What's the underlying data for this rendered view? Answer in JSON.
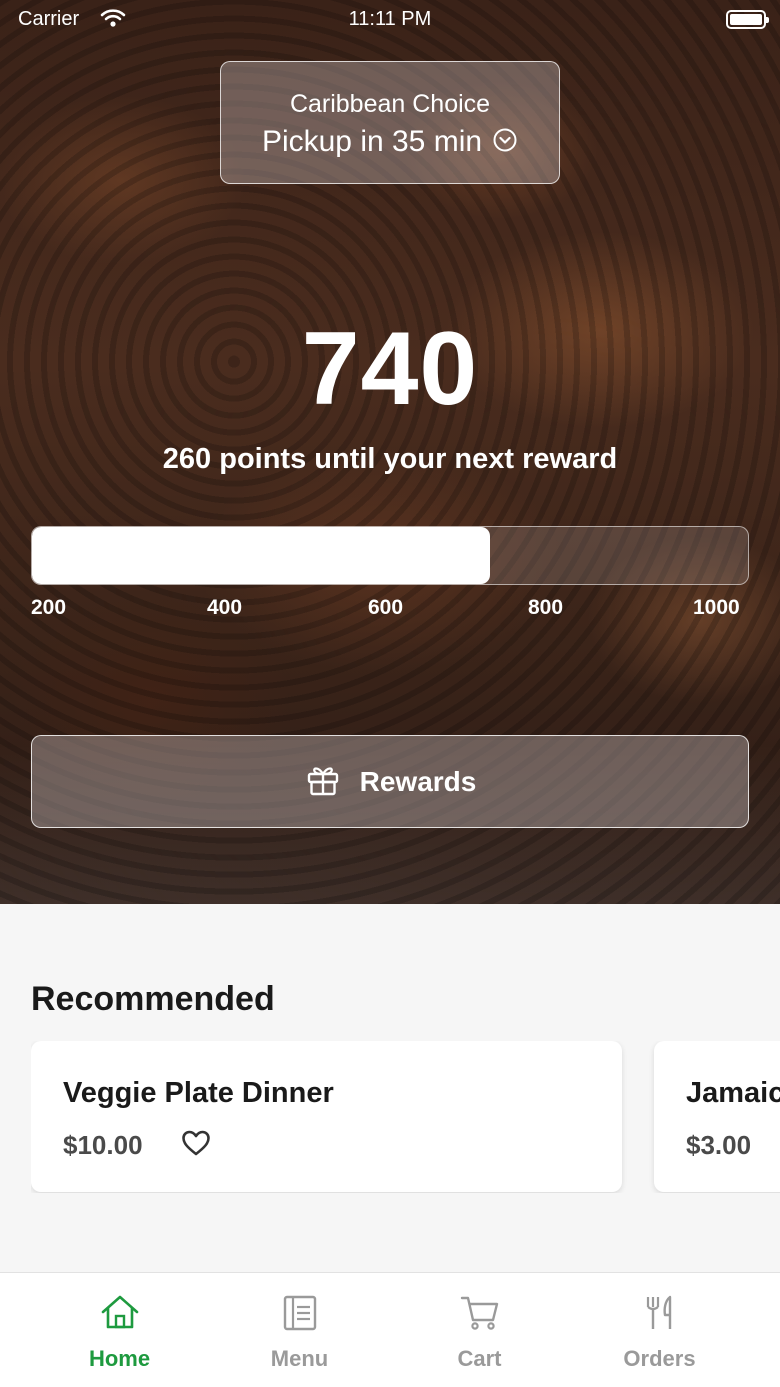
{
  "status_bar": {
    "carrier": "Carrier",
    "time": "11:11 PM"
  },
  "header": {
    "store_name": "Caribbean Choice",
    "pickup_label": "Pickup in 35 min"
  },
  "rewards": {
    "points": "740",
    "message": "260 points until your next reward",
    "progress_fraction": 0.64,
    "ticks": [
      "200",
      "400",
      "600",
      "800",
      "1000"
    ],
    "button_label": "Rewards"
  },
  "recommended": {
    "title": "Recommended",
    "items": [
      {
        "name": "Veggie Plate Dinner",
        "price": "$10.00"
      },
      {
        "name": "Jamaic",
        "price": "$3.00"
      }
    ]
  },
  "tabbar": {
    "active_color": "#1e9a3f",
    "inactive_color": "#9a9a9a",
    "tabs": [
      {
        "label": "Home",
        "icon": "home-icon",
        "active": true
      },
      {
        "label": "Menu",
        "icon": "menu-icon",
        "active": false
      },
      {
        "label": "Cart",
        "icon": "cart-icon",
        "active": false
      },
      {
        "label": "Orders",
        "icon": "orders-icon",
        "active": false
      }
    ]
  }
}
